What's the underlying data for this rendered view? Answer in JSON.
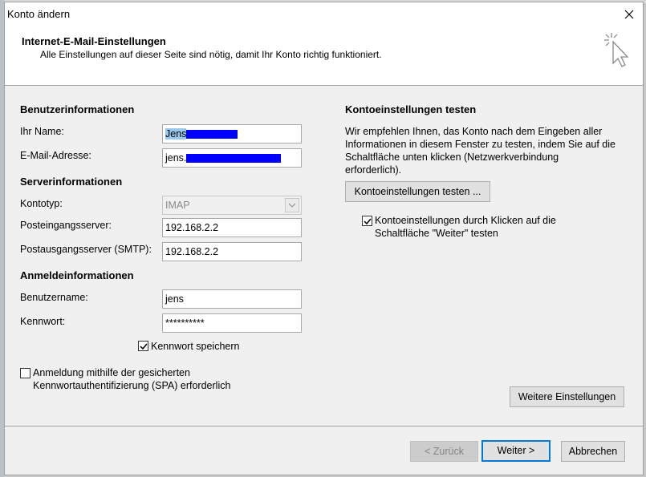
{
  "window": {
    "title": "Konto ändern"
  },
  "header": {
    "title": "Internet-E-Mail-Einstellungen",
    "subtitle": "Alle Einstellungen auf dieser Seite sind nötig, damit Ihr Konto richtig funktioniert."
  },
  "user_info": {
    "section_title": "Benutzerinformationen",
    "name_label": "Ihr Name:",
    "name_value": "Jens",
    "email_label": "E-Mail-Adresse:",
    "email_value": "jens."
  },
  "server_info": {
    "section_title": "Serverinformationen",
    "account_type_label": "Kontotyp:",
    "account_type_value": "IMAP",
    "incoming_label": "Posteingangsserver:",
    "incoming_value": "192.168.2.2",
    "outgoing_label": "Postausgangsserver (SMTP):",
    "outgoing_value": "192.168.2.2"
  },
  "login_info": {
    "section_title": "Anmeldeinformationen",
    "username_label": "Benutzername:",
    "username_value": "jens",
    "password_label": "Kennwort:",
    "password_value": "**********",
    "save_password_label": "Kennwort speichern",
    "save_password_checked": true,
    "spa_line1": "Anmeldung mithilfe der gesicherten",
    "spa_line2": "Kennwortauthentifizierung (SPA) erforderlich",
    "spa_checked": false
  },
  "test_settings": {
    "section_title": "Kontoeinstellungen testen",
    "desc_line1": "Wir empfehlen Ihnen, das Konto nach dem Eingeben aller",
    "desc_line2": "Informationen in diesem Fenster zu testen, indem Sie auf die",
    "desc_line3": "Schaltfläche unten klicken (Netzwerkverbindung",
    "desc_line4": "erforderlich).",
    "test_button": "Kontoeinstellungen testen ...",
    "auto_test_line1": "Kontoeinstellungen durch Klicken auf die",
    "auto_test_line2": "Schaltfläche \"Weiter\" testen",
    "auto_test_checked": true
  },
  "buttons": {
    "more_settings": "Weitere Einstellungen",
    "back": "< Zurück",
    "next": "Weiter >",
    "cancel": "Abbrechen"
  },
  "colors": {
    "accent": "#0078d7",
    "redaction": "#0000ff",
    "selection": "#99c9ef"
  }
}
